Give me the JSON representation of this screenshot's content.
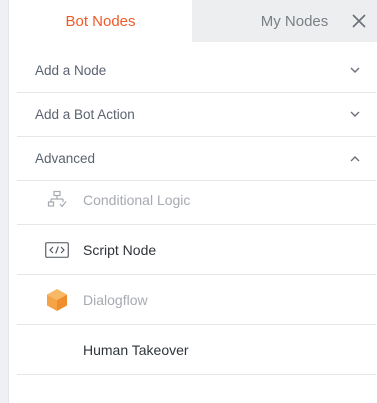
{
  "tabs": [
    {
      "label": "Bot Nodes",
      "active": true
    },
    {
      "label": "My Nodes",
      "active": false
    }
  ],
  "close_icon": "close-icon",
  "sections": [
    {
      "label": "Add a Node",
      "expanded": false
    },
    {
      "label": "Add a Bot Action",
      "expanded": false
    },
    {
      "label": "Advanced",
      "expanded": true
    }
  ],
  "advanced_nodes": [
    {
      "label": "Conditional Logic",
      "icon": "flowchart-icon",
      "disabled": true
    },
    {
      "label": "Script Node",
      "icon": "code-icon",
      "disabled": false
    },
    {
      "label": "Dialogflow",
      "icon": "dialogflow-icon",
      "disabled": true
    },
    {
      "label": "Human Takeover",
      "icon": "",
      "disabled": false
    }
  ],
  "colors": {
    "accent": "#f05a28",
    "inactive_tab_bg": "#eceeef",
    "dialogflow": "#f5a445"
  }
}
